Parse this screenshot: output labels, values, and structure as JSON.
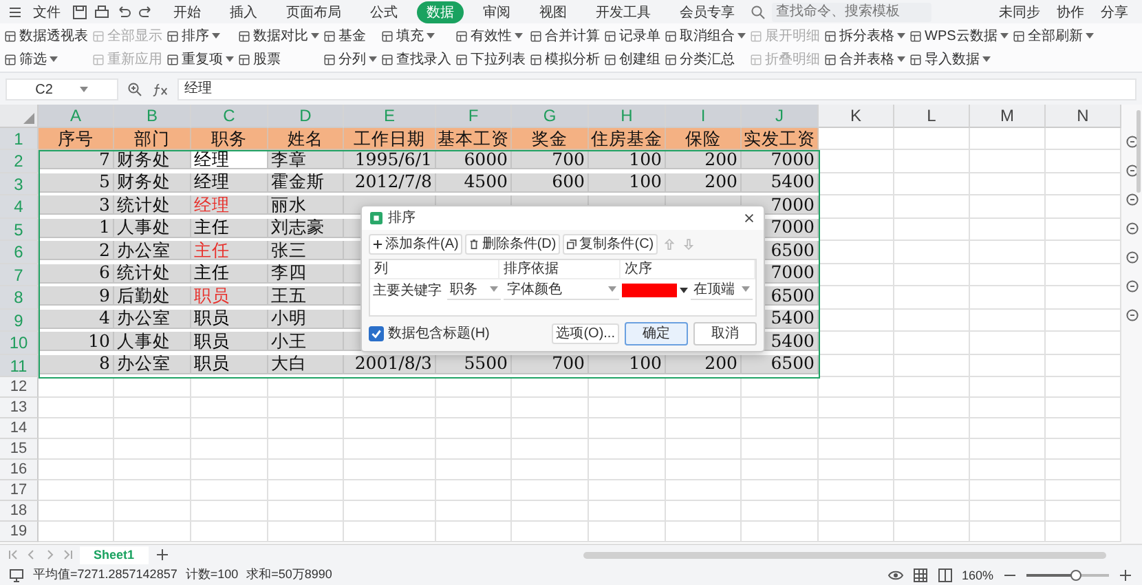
{
  "menubar": {
    "file": "文件",
    "tabs": [
      {
        "label": "开始",
        "selected": false
      },
      {
        "label": "插入",
        "selected": false
      },
      {
        "label": "页面布局",
        "selected": false
      },
      {
        "label": "公式",
        "selected": false
      },
      {
        "label": "数据",
        "selected": true
      },
      {
        "label": "审阅",
        "selected": false
      },
      {
        "label": "视图",
        "selected": false
      },
      {
        "label": "开发工具",
        "selected": false
      },
      {
        "label": "会员专享",
        "selected": false
      }
    ],
    "search": {
      "placeholder": "查找命令、搜索模板"
    },
    "actions": [
      "未同步",
      "协作",
      "分享"
    ]
  },
  "ribbon": {
    "items": [
      {
        "label": "数据透视表",
        "dropdown": false,
        "disabled": false
      },
      {
        "label": "筛选",
        "dropdown": true,
        "disabled": false
      },
      {
        "label": "全部显示",
        "dropdown": false,
        "disabled": true
      },
      {
        "label": "重新应用",
        "dropdown": false,
        "disabled": true
      },
      {
        "label": "排序",
        "dropdown": true,
        "disabled": false
      },
      {
        "label": "重复项",
        "dropdown": true,
        "disabled": false
      },
      {
        "label": "数据对比",
        "dropdown": true,
        "disabled": false
      },
      {
        "label": "股票",
        "dropdown": false,
        "disabled": false
      },
      {
        "label": "基金",
        "dropdown": false,
        "disabled": false
      },
      {
        "label": "分列",
        "dropdown": true,
        "disabled": false
      },
      {
        "label": "填充",
        "dropdown": true,
        "disabled": false
      },
      {
        "label": "查找录入",
        "dropdown": false,
        "disabled": false
      },
      {
        "label": "有效性",
        "dropdown": true,
        "disabled": false
      },
      {
        "label": "下拉列表",
        "dropdown": false,
        "disabled": false
      },
      {
        "label": "合并计算",
        "dropdown": false,
        "disabled": false
      },
      {
        "label": "模拟分析",
        "dropdown": false,
        "disabled": false
      },
      {
        "label": "记录单",
        "dropdown": false,
        "disabled": false
      },
      {
        "label": "创建组",
        "dropdown": false,
        "disabled": false
      },
      {
        "label": "取消组合",
        "dropdown": true,
        "disabled": false
      },
      {
        "label": "分类汇总",
        "dropdown": false,
        "disabled": false
      },
      {
        "label": "展开明细",
        "dropdown": false,
        "disabled": true
      },
      {
        "label": "折叠明细",
        "dropdown": false,
        "disabled": true
      },
      {
        "label": "拆分表格",
        "dropdown": true,
        "disabled": false
      },
      {
        "label": "合并表格",
        "dropdown": true,
        "disabled": false
      },
      {
        "label": "WPS云数据",
        "dropdown": true,
        "disabled": false
      },
      {
        "label": "导入数据",
        "dropdown": true,
        "disabled": false
      },
      {
        "label": "全部刷新",
        "dropdown": true,
        "disabled": false
      }
    ]
  },
  "formula_bar": {
    "cell": "C2",
    "value": "经理"
  },
  "sheet": {
    "columns": [
      {
        "label": "A",
        "selected": true
      },
      {
        "label": "B",
        "selected": true
      },
      {
        "label": "C",
        "selected": true
      },
      {
        "label": "D",
        "selected": true
      },
      {
        "label": "E",
        "selected": true
      },
      {
        "label": "F",
        "selected": true
      },
      {
        "label": "G",
        "selected": true
      },
      {
        "label": "H",
        "selected": true
      },
      {
        "label": "I",
        "selected": true
      },
      {
        "label": "J",
        "selected": true
      },
      {
        "label": "K",
        "selected": false
      },
      {
        "label": "L",
        "selected": false
      },
      {
        "label": "M",
        "selected": false
      },
      {
        "label": "N",
        "selected": false
      }
    ],
    "rows": [
      {
        "number": "1",
        "selected": true,
        "kind": "header",
        "cells": [
          "序号",
          "部门",
          "职务",
          "姓名",
          "工作日期",
          "基本工资",
          "奖金",
          "住房基金",
          "保险",
          "实发工资"
        ]
      },
      {
        "number": "2",
        "selected": true,
        "kind": "data",
        "color": "#000000",
        "active": true,
        "cells": [
          "7",
          "财务处",
          "经理",
          "李章",
          "1995/6/1",
          "6000",
          "700",
          "100",
          "200",
          "7000"
        ]
      },
      {
        "number": "3",
        "selected": true,
        "kind": "data",
        "color": "#000000",
        "active": false,
        "cells": [
          "5",
          "财务处",
          "经理",
          "霍金斯",
          "2012/7/8",
          "4500",
          "600",
          "100",
          "200",
          "5400"
        ]
      },
      {
        "number": "4",
        "selected": true,
        "kind": "data",
        "color": "#e8302b",
        "active": false,
        "cells": [
          "3",
          "统计处",
          "经理",
          "丽水",
          null,
          null,
          null,
          null,
          null,
          "7000"
        ]
      },
      {
        "number": "5",
        "selected": true,
        "kind": "data",
        "color": "#000000",
        "active": false,
        "cells": [
          "1",
          "人事处",
          "主任",
          "刘志豪",
          null,
          null,
          null,
          null,
          null,
          "7000"
        ]
      },
      {
        "number": "6",
        "selected": true,
        "kind": "data",
        "color": "#e8302b",
        "active": false,
        "cells": [
          "2",
          "办公室",
          "主任",
          "张三",
          null,
          null,
          null,
          null,
          null,
          "6500"
        ]
      },
      {
        "number": "7",
        "selected": true,
        "kind": "data",
        "color": "#000000",
        "active": false,
        "cells": [
          "6",
          "统计处",
          "主任",
          "李四",
          null,
          null,
          null,
          null,
          null,
          "7000"
        ]
      },
      {
        "number": "8",
        "selected": true,
        "kind": "data",
        "color": "#e8302b",
        "active": false,
        "cells": [
          "9",
          "后勤处",
          "职员",
          "王五",
          null,
          null,
          null,
          null,
          null,
          "6500"
        ]
      },
      {
        "number": "9",
        "selected": true,
        "kind": "data",
        "color": "#000000",
        "active": false,
        "cells": [
          "4",
          "办公室",
          "职员",
          "小明",
          null,
          null,
          null,
          null,
          null,
          "5400"
        ]
      },
      {
        "number": "10",
        "selected": true,
        "kind": "data",
        "color": "#000000",
        "active": false,
        "cells": [
          "10",
          "人事处",
          "职员",
          "小王",
          null,
          null,
          null,
          null,
          null,
          "5400"
        ]
      },
      {
        "number": "11",
        "selected": true,
        "kind": "data",
        "color": "#000000",
        "active": false,
        "cells": [
          "8",
          "办公室",
          "职员",
          "大白",
          "2001/8/3",
          "5500",
          "700",
          "100",
          "200",
          "6500"
        ]
      },
      {
        "number": "12",
        "selected": false,
        "kind": "empty"
      },
      {
        "number": "13",
        "selected": false,
        "kind": "empty"
      },
      {
        "number": "14",
        "selected": false,
        "kind": "empty"
      },
      {
        "number": "15",
        "selected": false,
        "kind": "empty"
      },
      {
        "number": "16",
        "selected": false,
        "kind": "empty"
      },
      {
        "number": "17",
        "selected": false,
        "kind": "empty"
      },
      {
        "number": "18",
        "selected": false,
        "kind": "empty"
      },
      {
        "number": "19",
        "selected": false,
        "kind": "empty"
      }
    ]
  },
  "dialog": {
    "title": "排序",
    "toolbar": [
      {
        "kind": "add",
        "label": "添加条件(A)",
        "disabled": false
      },
      {
        "kind": "delete",
        "label": "删除条件(D)",
        "disabled": false
      },
      {
        "kind": "copy",
        "label": "复制条件(C)",
        "disabled": false
      },
      {
        "kind": "up",
        "disabled": true
      },
      {
        "kind": "down",
        "disabled": true
      },
      {
        "kind": "options",
        "label": "选项(O)...",
        "disabled": false
      }
    ],
    "header_checkbox": {
      "label": "数据包含标题(H)",
      "checked": true
    },
    "columns": [
      "列",
      "排序依据",
      "次序"
    ],
    "conditions": [
      {
        "key": "主要关键字",
        "column": "职务",
        "sort_on": "字体颜色",
        "color": "#ff0000",
        "order": "在顶端"
      }
    ],
    "buttons": [
      {
        "label": "确定",
        "primary": true
      },
      {
        "label": "取消",
        "primary": false
      }
    ]
  },
  "sheet_tabs": [
    {
      "label": "Sheet1",
      "selected": true
    }
  ],
  "status_bar": {
    "average": "平均值=7271.2857142857",
    "count": "计数=100",
    "sum": "求和=50万8990",
    "zoom": "160%",
    "zoom_slider": {
      "level": 0.6
    }
  }
}
